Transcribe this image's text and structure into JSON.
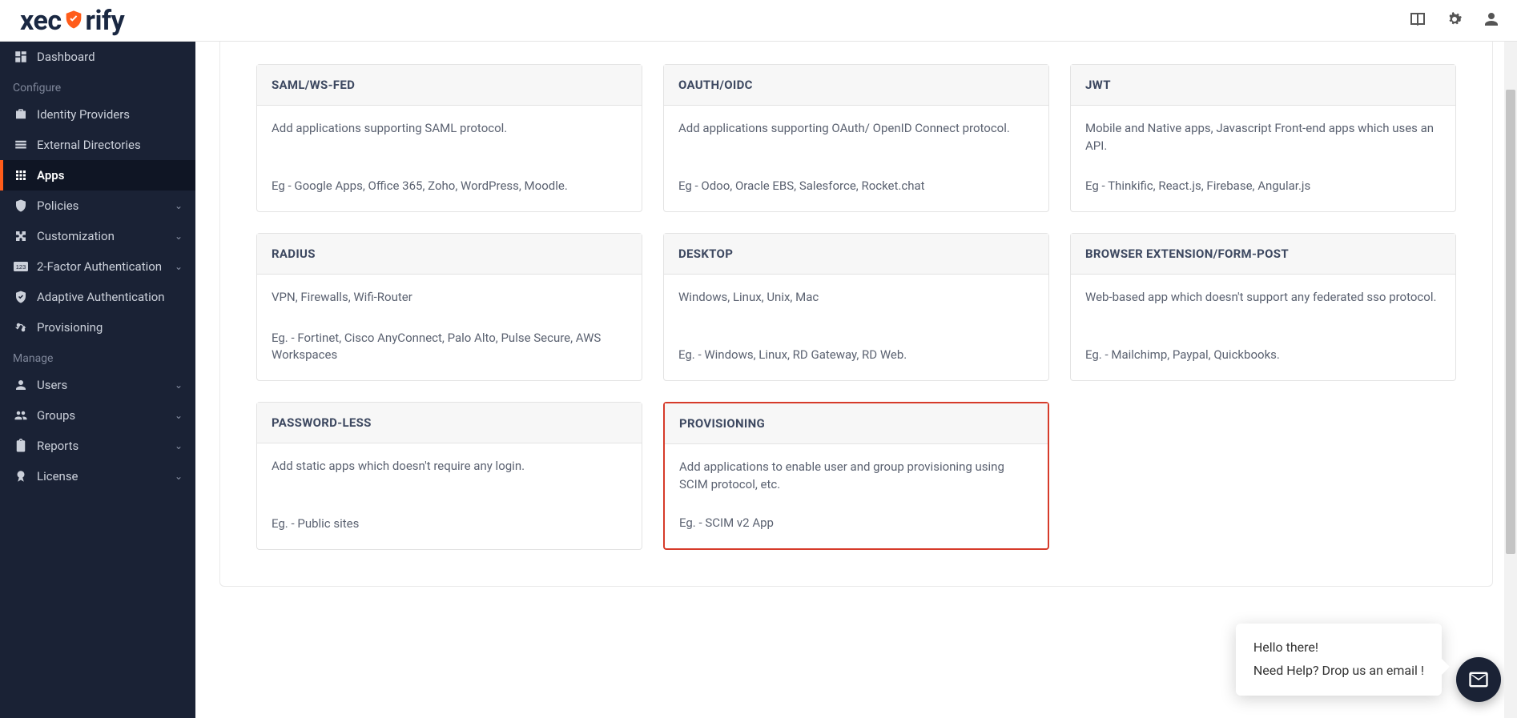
{
  "brand": {
    "name_pre": "xec",
    "name_post": "rify"
  },
  "topbar": {
    "book_icon": "book",
    "gear_icon": "gear",
    "user_icon": "user"
  },
  "sidebar": {
    "section_configure": "Configure",
    "section_manage": "Manage",
    "items": {
      "dashboard": "Dashboard",
      "idp": "Identity Providers",
      "ext_dir": "External Directories",
      "apps": "Apps",
      "policies": "Policies",
      "customization": "Customization",
      "tfa": "2-Factor Authentication",
      "adaptive": "Adaptive Authentication",
      "provisioning": "Provisioning",
      "users": "Users",
      "groups": "Groups",
      "reports": "Reports",
      "license": "License"
    }
  },
  "cards": [
    {
      "title": "SAML/WS-FED",
      "desc": "Add applications supporting SAML protocol.",
      "eg": "Eg - Google Apps, Office 365, Zoho, WordPress, Moodle."
    },
    {
      "title": "OAUTH/OIDC",
      "desc": "Add applications supporting OAuth/ OpenID Connect protocol.",
      "eg": "Eg - Odoo, Oracle EBS, Salesforce, Rocket.chat"
    },
    {
      "title": "JWT",
      "desc": "Mobile and Native apps, Javascript Front-end apps which uses an API.",
      "eg": "Eg - Thinkific, React.js, Firebase, Angular.js"
    },
    {
      "title": "RADIUS",
      "desc": "VPN, Firewalls, Wifi-Router",
      "eg": "Eg. - Fortinet, Cisco AnyConnect, Palo Alto, Pulse Secure, AWS Workspaces"
    },
    {
      "title": "DESKTOP",
      "desc": "Windows, Linux, Unix, Mac",
      "eg": "Eg. - Windows, Linux, RD Gateway, RD Web."
    },
    {
      "title": "BROWSER EXTENSION/FORM-POST",
      "desc": "Web-based app which doesn't support any federated sso protocol.",
      "eg": "Eg. - Mailchimp, Paypal, Quickbooks."
    },
    {
      "title": "PASSWORD-LESS",
      "desc": "Add static apps which doesn't require any login.",
      "eg": "Eg. - Public sites"
    },
    {
      "title": "PROVISIONING",
      "desc": "Add applications to enable user and group provisioning using SCIM protocol, etc.",
      "eg": "Eg. - SCIM v2 App",
      "highlighted": true
    }
  ],
  "chat": {
    "line1": "Hello there!",
    "line2": "Need Help? Drop us an email !"
  }
}
